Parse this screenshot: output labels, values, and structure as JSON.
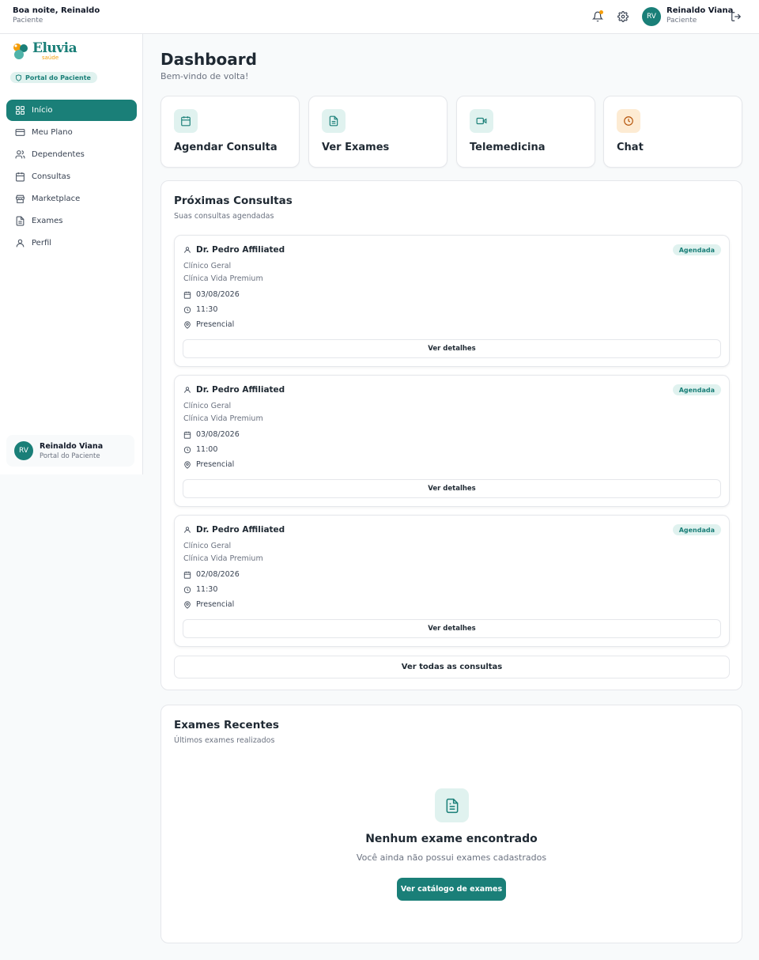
{
  "header": {
    "greeting": "Boa noite, Reinaldo",
    "role": "Paciente",
    "user_initials": "RV",
    "user_name": "Reinaldo Viana",
    "user_role": "Paciente",
    "icons": [
      "bell-icon",
      "gear-icon",
      "logout-icon"
    ]
  },
  "sidebar": {
    "logo_text": "Eluvia",
    "logo_sub": "saúde",
    "portal_label": "Portal do Paciente",
    "items": [
      {
        "label": "Início",
        "icon": "grid-icon",
        "active": true
      },
      {
        "label": "Meu Plano",
        "icon": "card-icon"
      },
      {
        "label": "Dependentes",
        "icon": "users-icon"
      },
      {
        "label": "Consultas",
        "icon": "calendar-icon"
      },
      {
        "label": "Marketplace",
        "icon": "store-icon"
      },
      {
        "label": "Exames",
        "icon": "file-icon"
      },
      {
        "label": "Perfil",
        "icon": "user-icon"
      }
    ],
    "user_initials": "RV",
    "user_name": "Reinaldo Viana",
    "user_role": "Portal do Paciente"
  },
  "main": {
    "title": "Dashboard",
    "subtitle": "Bem-vindo de volta!",
    "quick_actions": [
      {
        "label": "Agendar Consulta",
        "icon": "calendar-icon",
        "color": "#e0f2ef"
      },
      {
        "label": "Ver Exames",
        "icon": "file-icon",
        "color": "#e0f2ef"
      },
      {
        "label": "Telemedicina",
        "icon": "video-icon",
        "color": "#e0f2ef"
      },
      {
        "label": "Chat",
        "icon": "clock-icon",
        "color": "#fdebd3"
      }
    ],
    "appointments": {
      "title": "Próximas Consultas",
      "subtitle": "Suas consultas agendadas",
      "items": [
        {
          "doctor": "Dr. Pedro Affiliated",
          "status": "Agendada",
          "specialty": "Clínico Geral",
          "clinic": "Clínica Vida Premium",
          "date": "03/08/2026",
          "time": "11:30",
          "mode": "Presencial",
          "button": "Ver detalhes"
        },
        {
          "doctor": "Dr. Pedro Affiliated",
          "status": "Agendada",
          "specialty": "Clínico Geral",
          "clinic": "Clínica Vida Premium",
          "date": "03/08/2026",
          "time": "11:00",
          "mode": "Presencial",
          "button": "Ver detalhes"
        },
        {
          "doctor": "Dr. Pedro Affiliated",
          "status": "Agendada",
          "specialty": "Clínico Geral",
          "clinic": "Clínica Vida Premium",
          "date": "02/08/2026",
          "time": "11:30",
          "mode": "Presencial",
          "button": "Ver detalhes"
        }
      ],
      "all_button": "Ver todas as consultas"
    },
    "exams": {
      "title": "Exames Recentes",
      "subtitle": "Últimos exames realizados",
      "empty_title": "Nenhum exame encontrado",
      "empty_sub": "Você ainda não possui exames cadastrados",
      "button": "Ver catálogo de exames"
    }
  },
  "colors": {
    "accent": "#1a7f78",
    "accent_light": "#e0f2ef",
    "orange": "#f59e0b"
  }
}
